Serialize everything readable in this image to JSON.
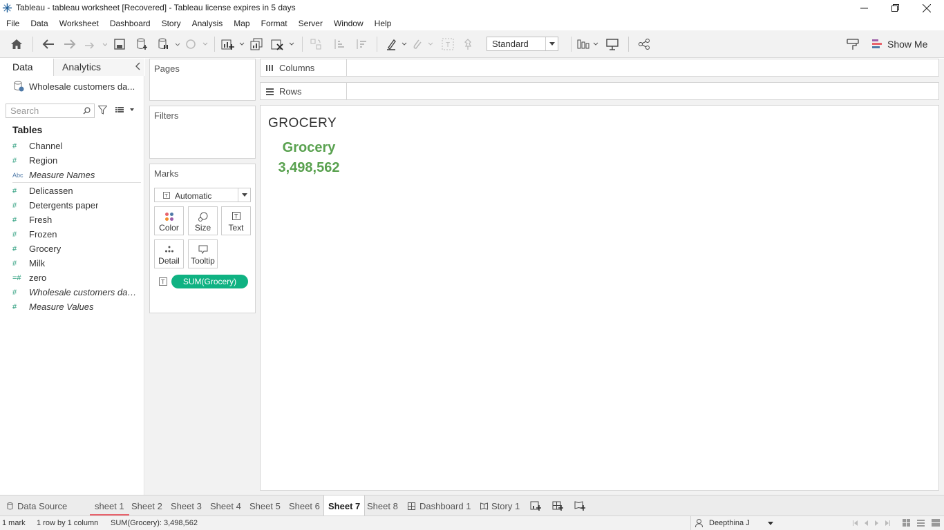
{
  "window": {
    "title": "Tableau - tableau worksheet [Recovered] - Tableau license expires in 5 days"
  },
  "menu": [
    "File",
    "Data",
    "Worksheet",
    "Dashboard",
    "Story",
    "Analysis",
    "Map",
    "Format",
    "Server",
    "Window",
    "Help"
  ],
  "toolbar": {
    "fit_value": "Standard",
    "show_me_label": "Show Me"
  },
  "data_pane": {
    "tab_data": "Data",
    "tab_analytics": "Analytics",
    "datasource_name": "Wholesale customers da...",
    "search_placeholder": "Search",
    "tables_heading": "Tables",
    "fields": [
      {
        "icon": "#",
        "name": "Channel"
      },
      {
        "icon": "#",
        "name": "Region"
      },
      {
        "icon": "Abc",
        "name": "Measure Names"
      },
      {
        "icon": "#",
        "name": "Delicassen"
      },
      {
        "icon": "#",
        "name": "Detergents paper"
      },
      {
        "icon": "#",
        "name": "Fresh"
      },
      {
        "icon": "#",
        "name": "Frozen"
      },
      {
        "icon": "#",
        "name": "Grocery"
      },
      {
        "icon": "#",
        "name": "Milk"
      },
      {
        "icon": "=#",
        "name": "zero"
      },
      {
        "icon": "#",
        "name": "Wholesale customers dat..."
      },
      {
        "icon": "#",
        "name": "Measure Values"
      }
    ]
  },
  "cards": {
    "pages": "Pages",
    "filters": "Filters",
    "marks": "Marks",
    "mark_type": "Automatic",
    "buttons": {
      "color": "Color",
      "size": "Size",
      "text": "Text",
      "detail": "Detail",
      "tooltip": "Tooltip"
    },
    "pill": "SUM(Grocery)"
  },
  "shelves": {
    "columns": "Columns",
    "rows": "Rows"
  },
  "view": {
    "title": "GROCERY",
    "kpi_label": "Grocery",
    "kpi_value": "3,498,562",
    "accent_color": "#59a14f"
  },
  "sheet_tabs": {
    "data_source": "Data Source",
    "sheets": [
      "sheet 1",
      "Sheet 2",
      "Sheet 3",
      "Sheet 4",
      "Sheet 5",
      "Sheet 6",
      "Sheet 7",
      "Sheet 8"
    ],
    "dashboard": "Dashboard 1",
    "story": "Story 1",
    "active": "Sheet 7"
  },
  "status": {
    "marks": "1 mark",
    "dims": "1 row by 1 column",
    "sum": "SUM(Grocery): 3,498,562",
    "user": "Deepthina J"
  }
}
